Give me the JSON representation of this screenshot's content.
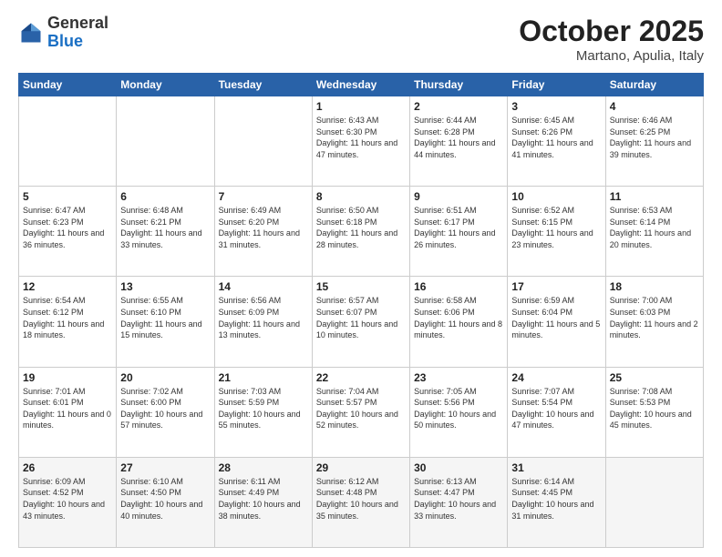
{
  "header": {
    "logo_general": "General",
    "logo_blue": "Blue",
    "month_title": "October 2025",
    "location": "Martano, Apulia, Italy"
  },
  "weekdays": [
    "Sunday",
    "Monday",
    "Tuesday",
    "Wednesday",
    "Thursday",
    "Friday",
    "Saturday"
  ],
  "weeks": [
    [
      {
        "day": "",
        "sunrise": "",
        "sunset": "",
        "daylight": ""
      },
      {
        "day": "",
        "sunrise": "",
        "sunset": "",
        "daylight": ""
      },
      {
        "day": "",
        "sunrise": "",
        "sunset": "",
        "daylight": ""
      },
      {
        "day": "1",
        "sunrise": "Sunrise: 6:43 AM",
        "sunset": "Sunset: 6:30 PM",
        "daylight": "Daylight: 11 hours and 47 minutes."
      },
      {
        "day": "2",
        "sunrise": "Sunrise: 6:44 AM",
        "sunset": "Sunset: 6:28 PM",
        "daylight": "Daylight: 11 hours and 44 minutes."
      },
      {
        "day": "3",
        "sunrise": "Sunrise: 6:45 AM",
        "sunset": "Sunset: 6:26 PM",
        "daylight": "Daylight: 11 hours and 41 minutes."
      },
      {
        "day": "4",
        "sunrise": "Sunrise: 6:46 AM",
        "sunset": "Sunset: 6:25 PM",
        "daylight": "Daylight: 11 hours and 39 minutes."
      }
    ],
    [
      {
        "day": "5",
        "sunrise": "Sunrise: 6:47 AM",
        "sunset": "Sunset: 6:23 PM",
        "daylight": "Daylight: 11 hours and 36 minutes."
      },
      {
        "day": "6",
        "sunrise": "Sunrise: 6:48 AM",
        "sunset": "Sunset: 6:21 PM",
        "daylight": "Daylight: 11 hours and 33 minutes."
      },
      {
        "day": "7",
        "sunrise": "Sunrise: 6:49 AM",
        "sunset": "Sunset: 6:20 PM",
        "daylight": "Daylight: 11 hours and 31 minutes."
      },
      {
        "day": "8",
        "sunrise": "Sunrise: 6:50 AM",
        "sunset": "Sunset: 6:18 PM",
        "daylight": "Daylight: 11 hours and 28 minutes."
      },
      {
        "day": "9",
        "sunrise": "Sunrise: 6:51 AM",
        "sunset": "Sunset: 6:17 PM",
        "daylight": "Daylight: 11 hours and 26 minutes."
      },
      {
        "day": "10",
        "sunrise": "Sunrise: 6:52 AM",
        "sunset": "Sunset: 6:15 PM",
        "daylight": "Daylight: 11 hours and 23 minutes."
      },
      {
        "day": "11",
        "sunrise": "Sunrise: 6:53 AM",
        "sunset": "Sunset: 6:14 PM",
        "daylight": "Daylight: 11 hours and 20 minutes."
      }
    ],
    [
      {
        "day": "12",
        "sunrise": "Sunrise: 6:54 AM",
        "sunset": "Sunset: 6:12 PM",
        "daylight": "Daylight: 11 hours and 18 minutes."
      },
      {
        "day": "13",
        "sunrise": "Sunrise: 6:55 AM",
        "sunset": "Sunset: 6:10 PM",
        "daylight": "Daylight: 11 hours and 15 minutes."
      },
      {
        "day": "14",
        "sunrise": "Sunrise: 6:56 AM",
        "sunset": "Sunset: 6:09 PM",
        "daylight": "Daylight: 11 hours and 13 minutes."
      },
      {
        "day": "15",
        "sunrise": "Sunrise: 6:57 AM",
        "sunset": "Sunset: 6:07 PM",
        "daylight": "Daylight: 11 hours and 10 minutes."
      },
      {
        "day": "16",
        "sunrise": "Sunrise: 6:58 AM",
        "sunset": "Sunset: 6:06 PM",
        "daylight": "Daylight: 11 hours and 8 minutes."
      },
      {
        "day": "17",
        "sunrise": "Sunrise: 6:59 AM",
        "sunset": "Sunset: 6:04 PM",
        "daylight": "Daylight: 11 hours and 5 minutes."
      },
      {
        "day": "18",
        "sunrise": "Sunrise: 7:00 AM",
        "sunset": "Sunset: 6:03 PM",
        "daylight": "Daylight: 11 hours and 2 minutes."
      }
    ],
    [
      {
        "day": "19",
        "sunrise": "Sunrise: 7:01 AM",
        "sunset": "Sunset: 6:01 PM",
        "daylight": "Daylight: 11 hours and 0 minutes."
      },
      {
        "day": "20",
        "sunrise": "Sunrise: 7:02 AM",
        "sunset": "Sunset: 6:00 PM",
        "daylight": "Daylight: 10 hours and 57 minutes."
      },
      {
        "day": "21",
        "sunrise": "Sunrise: 7:03 AM",
        "sunset": "Sunset: 5:59 PM",
        "daylight": "Daylight: 10 hours and 55 minutes."
      },
      {
        "day": "22",
        "sunrise": "Sunrise: 7:04 AM",
        "sunset": "Sunset: 5:57 PM",
        "daylight": "Daylight: 10 hours and 52 minutes."
      },
      {
        "day": "23",
        "sunrise": "Sunrise: 7:05 AM",
        "sunset": "Sunset: 5:56 PM",
        "daylight": "Daylight: 10 hours and 50 minutes."
      },
      {
        "day": "24",
        "sunrise": "Sunrise: 7:07 AM",
        "sunset": "Sunset: 5:54 PM",
        "daylight": "Daylight: 10 hours and 47 minutes."
      },
      {
        "day": "25",
        "sunrise": "Sunrise: 7:08 AM",
        "sunset": "Sunset: 5:53 PM",
        "daylight": "Daylight: 10 hours and 45 minutes."
      }
    ],
    [
      {
        "day": "26",
        "sunrise": "Sunrise: 6:09 AM",
        "sunset": "Sunset: 4:52 PM",
        "daylight": "Daylight: 10 hours and 43 minutes."
      },
      {
        "day": "27",
        "sunrise": "Sunrise: 6:10 AM",
        "sunset": "Sunset: 4:50 PM",
        "daylight": "Daylight: 10 hours and 40 minutes."
      },
      {
        "day": "28",
        "sunrise": "Sunrise: 6:11 AM",
        "sunset": "Sunset: 4:49 PM",
        "daylight": "Daylight: 10 hours and 38 minutes."
      },
      {
        "day": "29",
        "sunrise": "Sunrise: 6:12 AM",
        "sunset": "Sunset: 4:48 PM",
        "daylight": "Daylight: 10 hours and 35 minutes."
      },
      {
        "day": "30",
        "sunrise": "Sunrise: 6:13 AM",
        "sunset": "Sunset: 4:47 PM",
        "daylight": "Daylight: 10 hours and 33 minutes."
      },
      {
        "day": "31",
        "sunrise": "Sunrise: 6:14 AM",
        "sunset": "Sunset: 4:45 PM",
        "daylight": "Daylight: 10 hours and 31 minutes."
      },
      {
        "day": "",
        "sunrise": "",
        "sunset": "",
        "daylight": ""
      }
    ]
  ]
}
